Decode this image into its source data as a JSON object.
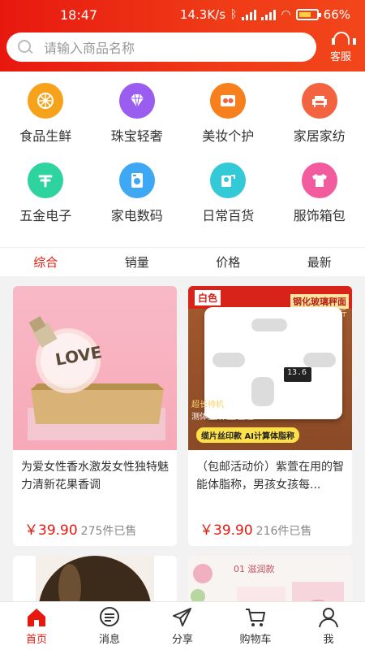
{
  "status_bar": {
    "time": "18:47",
    "speed": "14.3K/s",
    "battery": "66%"
  },
  "search": {
    "placeholder": "请输入商品名称"
  },
  "header": {
    "service_label": "客服"
  },
  "categories": [
    {
      "label": "食品生鲜",
      "icon": "orange-icon",
      "color": "#f7a21b"
    },
    {
      "label": "珠宝轻奢",
      "icon": "diamond-icon",
      "color": "#9b5cf0"
    },
    {
      "label": "美妆个护",
      "icon": "cosmetics-icon",
      "color": "#f7801c"
    },
    {
      "label": "家居家纺",
      "icon": "sofa-icon",
      "color": "#f46340"
    },
    {
      "label": "五金电子",
      "icon": "tool-icon",
      "color": "#2fd39e"
    },
    {
      "label": "家电数码",
      "icon": "washer-icon",
      "color": "#3fa8f5"
    },
    {
      "label": "日常百货",
      "icon": "tissue-icon",
      "color": "#34c9d6"
    },
    {
      "label": "服饰箱包",
      "icon": "tshirt-icon",
      "color": "#f25c9e"
    }
  ],
  "sort_tabs": [
    "综合",
    "销量",
    "价格",
    "最新"
  ],
  "active_tab": "综合",
  "products": [
    {
      "title": "为爱女性香水激发女性独特魅力清新花果香调",
      "price": "￥39.90",
      "sold": "275件已售",
      "image": "perfume-image"
    },
    {
      "title": "（包邮活动价）紫萱在用的智能体脂称，男孩女孩每...",
      "price": "￥39.90",
      "sold": "216件已售",
      "image": "body-scale-image",
      "image_text": {
        "tag": "白色",
        "banner": "钢化玻璃秤面",
        "sub": "可秤300斤",
        "note1": "超长待机",
        "note2": "测体重/体脂/室温",
        "note3": "缆片丝印款 AI计算体脂称",
        "display": "13.6"
      }
    },
    {
      "title": "",
      "price": "",
      "sold": "",
      "image": "bottle-image"
    },
    {
      "title": "",
      "price": "",
      "sold": "",
      "image": "cosmetics-image",
      "image_text": {
        "caption": "01 滋润款"
      }
    }
  ],
  "perfume_text": "LOVE",
  "nav": [
    {
      "label": "首页",
      "icon": "home-icon",
      "active": true
    },
    {
      "label": "消息",
      "icon": "message-icon",
      "active": false
    },
    {
      "label": "分享",
      "icon": "share-icon",
      "active": false
    },
    {
      "label": "购物车",
      "icon": "cart-icon",
      "active": false
    },
    {
      "label": "我",
      "icon": "user-icon",
      "active": false
    }
  ]
}
